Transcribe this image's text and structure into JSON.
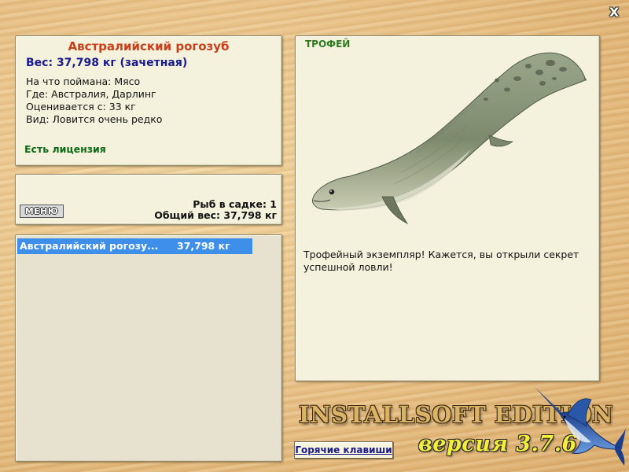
{
  "window": {
    "close_symbol": "X"
  },
  "fish": {
    "name": "Австралийский рогозуб",
    "weight": "Вес: 37,798 кг (зачетная)",
    "bait": "На что поймана: Мясо",
    "location": "Где: Австралия, Дарлинг",
    "valued_from": "Оценивается с: 33 кг",
    "rarity": "Вид: Ловится очень редко",
    "license": "Есть лицензия"
  },
  "keepnet": {
    "menu_label": "МЕНЮ",
    "fish_count": "Рыб в садке: 1",
    "total_weight": "Общий вес: 37,798 кг"
  },
  "catch_list": [
    {
      "name": "Австралийский рогозу...",
      "weight": "37,798 кг"
    }
  ],
  "trophy": {
    "label": "ТРОФЕЙ",
    "message": "Трофейный экземпляр! Кажется, вы открыли секрет успешной ловли!"
  },
  "hotkeys_label": "Горячие клавиши",
  "branding": {
    "edition": "INSTALLSOFT EDITION",
    "version": "версия 3.7.6"
  },
  "colors": {
    "fish_name": "#c8401a",
    "weight": "#1a1a8a",
    "license": "#0d6a14",
    "trophy_label": "#2f7a1e",
    "selected_row": "#3d8fe9",
    "version": "#f3ee3a"
  },
  "icons": {
    "close": "close-icon",
    "logo": "marlin-icon"
  }
}
